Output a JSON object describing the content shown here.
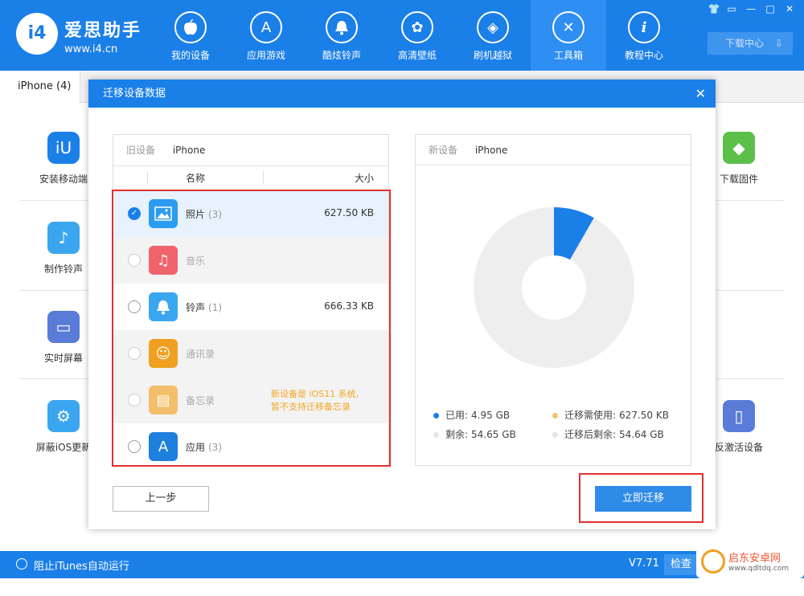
{
  "app": {
    "brand_name": "爱思助手",
    "brand_url": "www.i4.cn",
    "logo_text": "i4"
  },
  "nav": [
    {
      "label": "我的设备",
      "icon": "apple-icon",
      "glyph": ""
    },
    {
      "label": "应用游戏",
      "icon": "appstore-icon",
      "glyph": "A"
    },
    {
      "label": "酷炫铃声",
      "icon": "bell-icon",
      "glyph": "♪"
    },
    {
      "label": "高清壁纸",
      "icon": "flower-icon",
      "glyph": "✿"
    },
    {
      "label": "刷机越狱",
      "icon": "dropbox-icon",
      "glyph": "◈"
    },
    {
      "label": "工具箱",
      "icon": "tools-icon",
      "glyph": "✕"
    },
    {
      "label": "教程中心",
      "icon": "info-icon",
      "glyph": "i"
    }
  ],
  "window_controls": [
    "👕",
    "▭",
    "—",
    "□",
    "✕"
  ],
  "download_center": "下载中心",
  "device_tab": "iPhone (4)",
  "tools": {
    "install_mobile": "安装移动端",
    "make_ringtone": "制作铃声",
    "realtime_screen": "实时屏幕",
    "block_ios_update": "屏蔽iOS更新",
    "download_firmware": "下载固件",
    "deactivate": "反激活设备"
  },
  "bottom": {
    "itunes": "阻止iTunes自动运行",
    "version": "V7.71",
    "check": "检查更"
  },
  "modal": {
    "title": "迁移设备数据",
    "close": "✕",
    "old_device_key": "旧设备",
    "old_device_val": "iPhone",
    "new_device_key": "新设备",
    "new_device_val": "iPhone",
    "col_name": "名称",
    "col_size": "大小",
    "items": [
      {
        "name": "照片",
        "count": "(3)",
        "size": "627.50 KB",
        "state": "selected",
        "icon": "photos-icon",
        "color": "#2c9cf0",
        "glyph": "▣"
      },
      {
        "name": "音乐",
        "count": "",
        "size": "",
        "state": "disabled",
        "icon": "music-icon",
        "color": "#f0636d",
        "glyph": "♫"
      },
      {
        "name": "铃声",
        "count": "(1)",
        "size": "666.33 KB",
        "state": "normal",
        "icon": "ringtone-bell-icon",
        "color": "#3ba6f0",
        "glyph": "♪"
      },
      {
        "name": "通讯录",
        "count": "",
        "size": "",
        "state": "disabled",
        "icon": "contacts-icon",
        "color": "#f0a020",
        "glyph": "☺"
      },
      {
        "name": "备忘录",
        "count": "",
        "size": "",
        "state": "disabled",
        "icon": "notes-icon",
        "color": "#f3bf6b",
        "glyph": "▤"
      },
      {
        "name": "应用",
        "count": "(3)",
        "size": "",
        "state": "normal",
        "icon": "appstore-icon",
        "color": "#1f7fdd",
        "glyph": "A"
      }
    ],
    "notes_warning_line1": "新设备是 iOS11 系统,",
    "notes_warning_line2": "暂不支持迁移备忘录",
    "legend": {
      "used_label": "已用:",
      "used_value": "4.95 GB",
      "remain_label": "剩余:",
      "remain_value": "54.65 GB",
      "need_label": "迁移需使用:",
      "need_value": "627.50 KB",
      "after_label": "迁移后剩余:",
      "after_value": "54.64 GB"
    },
    "btn_prev": "上一步",
    "btn_migrate": "立即迁移"
  },
  "chart_data": {
    "type": "pie",
    "categories": [
      "已用",
      "剩余"
    ],
    "values": [
      4.95,
      54.65
    ],
    "colors": [
      "#1b7fe8",
      "#eeeeee"
    ]
  },
  "watermark": {
    "title": "启东安卓网",
    "sub": "www.qdltdq.com"
  }
}
